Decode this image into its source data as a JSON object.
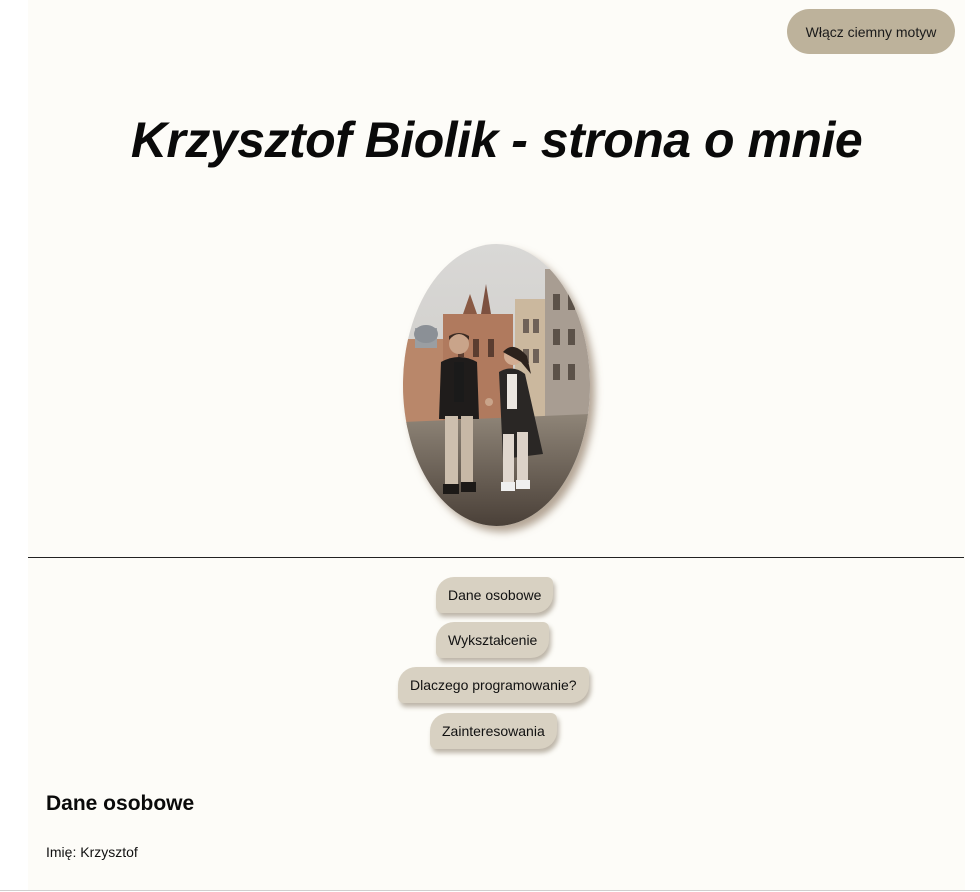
{
  "theme_toggle": {
    "label": "Włącz ciemny motyw"
  },
  "header": {
    "title": "Krzysztof Biolik - strona o mnie"
  },
  "nav": {
    "items": [
      {
        "label": "Dane osobowe"
      },
      {
        "label": "Wykształcenie"
      },
      {
        "label": "Dlaczego programowanie?"
      },
      {
        "label": "Zainteresowania"
      }
    ]
  },
  "section": {
    "heading": "Dane osobowe",
    "fields": [
      {
        "label": "Imię",
        "value": "Krzysztof",
        "text": "Imię: Krzysztof"
      }
    ]
  },
  "colors": {
    "page_background": "#fdfcf8",
    "toggle_background": "#bdb29b",
    "nav_item_background": "#d8d1c2",
    "divider": "#222222",
    "text": "#111111"
  }
}
